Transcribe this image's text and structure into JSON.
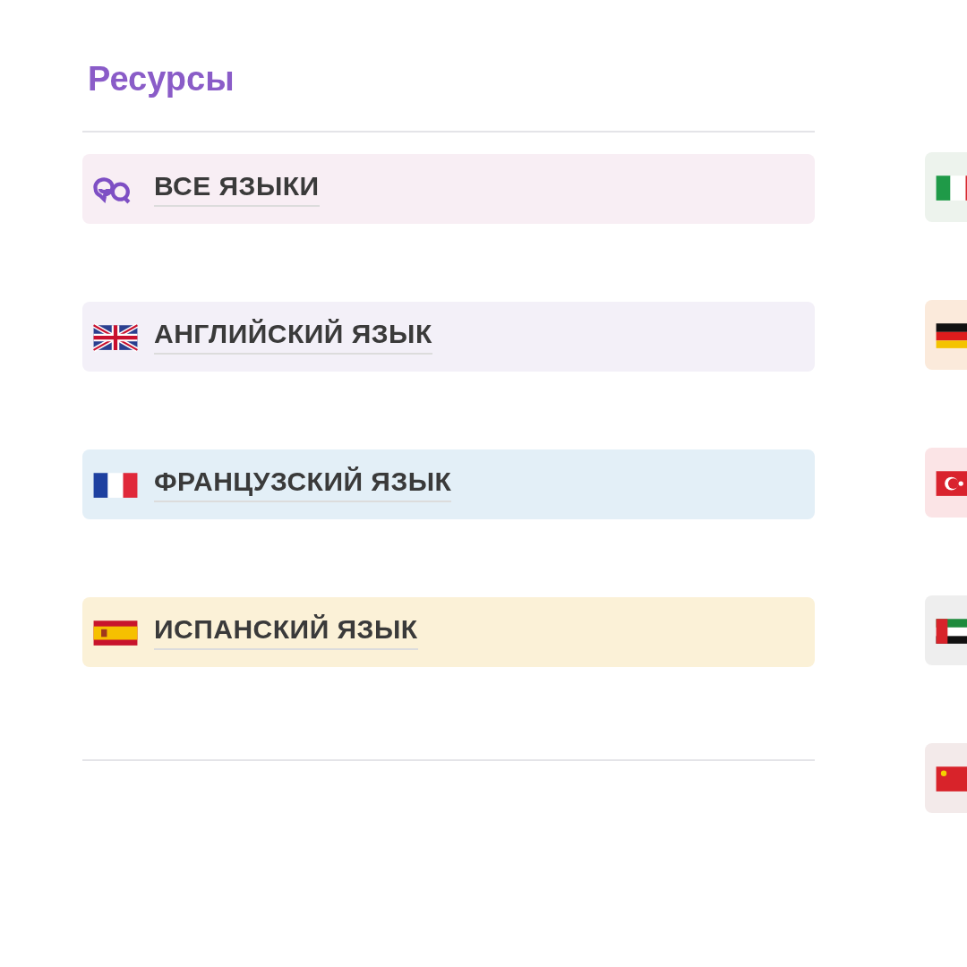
{
  "title": "Ресурсы",
  "languages": [
    {
      "label": "ВСЕ ЯЗЫКИ",
      "kind": "chat",
      "color": "#f8eef4"
    },
    {
      "label": "АНГЛИЙСКИЙ ЯЗЫК",
      "kind": "uk",
      "color": "#f3f0f8"
    },
    {
      "label": "ФРАНЦУЗСКИЙ ЯЗЫК",
      "kind": "fr",
      "color": "#e3eff7"
    },
    {
      "label": "ИСПАНСКИЙ ЯЗЫК",
      "kind": "es",
      "color": "#fbf1d7"
    }
  ],
  "more_languages": [
    {
      "kind": "it",
      "color": "#edf3ed"
    },
    {
      "kind": "de",
      "color": "#fbeadb"
    },
    {
      "kind": "tr",
      "color": "#fbe4e6"
    },
    {
      "kind": "ae",
      "color": "#eeeeee"
    },
    {
      "kind": "cn",
      "color": "#f3eaea"
    }
  ]
}
